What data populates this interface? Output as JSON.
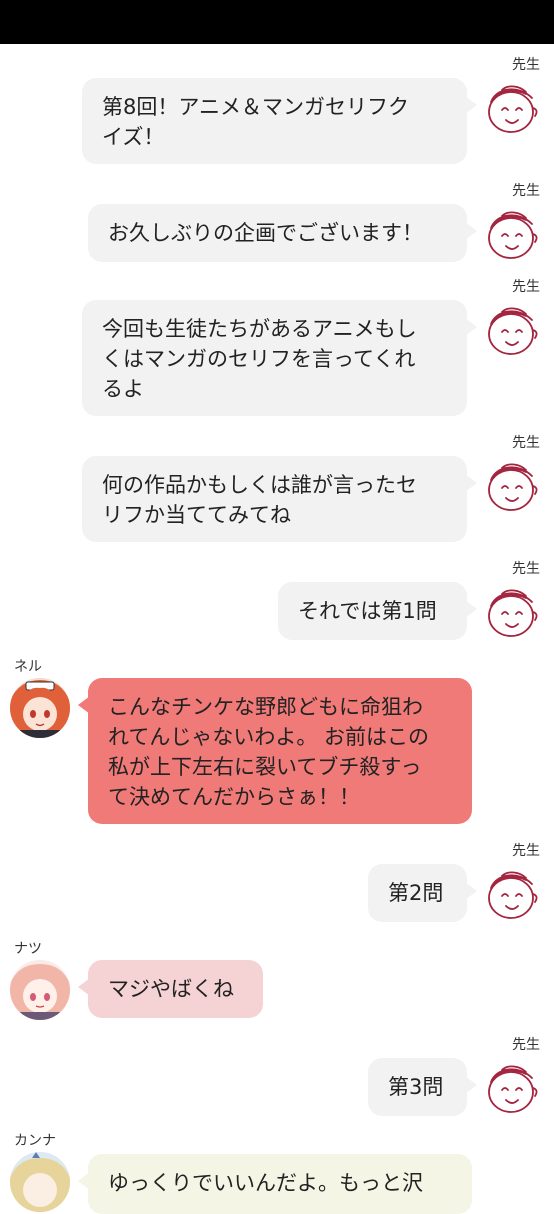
{
  "sensei_name": "先生",
  "messages": [
    {
      "sender": "先生",
      "text": "第8回！アニメ＆マンガセリフク\nイズ！"
    },
    {
      "sender": "先生",
      "text": "お久しぶりの企画でございます！"
    },
    {
      "sender": "先生",
      "text": "今回も生徒たちがあるアニメもし\nくはマンガのセリフを言ってくれ\nるよ"
    },
    {
      "sender": "先生",
      "text": "何の作品かもしくは誰が言ったセ\nリフか当ててみてね"
    },
    {
      "sender": "先生",
      "text": "それでは第1問"
    },
    {
      "sender": "ネル",
      "text": "こんなチンケな野郎どもに命狙わ\nれてんじゃないわよ。 お前はこの\n私が上下左右に裂いてブチ殺すっ\nて決めてんだからさぁ！！"
    },
    {
      "sender": "先生",
      "text": "第2問"
    },
    {
      "sender": "ナツ",
      "text": "マジやばくね"
    },
    {
      "sender": "先生",
      "text": "第3問"
    },
    {
      "sender": "カンナ",
      "text": "ゆっくりでいいんだよ。もっと沢"
    }
  ],
  "colors": {
    "sensei_bubble": "#f2f2f2",
    "neru_bubble": "#f07a78",
    "natsu_bubble": "#f5d3d5",
    "kanna_bubble": "#f4f5e4",
    "sensei_icon": "#a3253f"
  },
  "icons": {
    "sensei_avatar": "smiling-face-doodle-icon",
    "neru_avatar": "neru-avatar-icon",
    "natsu_avatar": "natsu-avatar-icon",
    "kanna_avatar": "kanna-avatar-icon"
  }
}
